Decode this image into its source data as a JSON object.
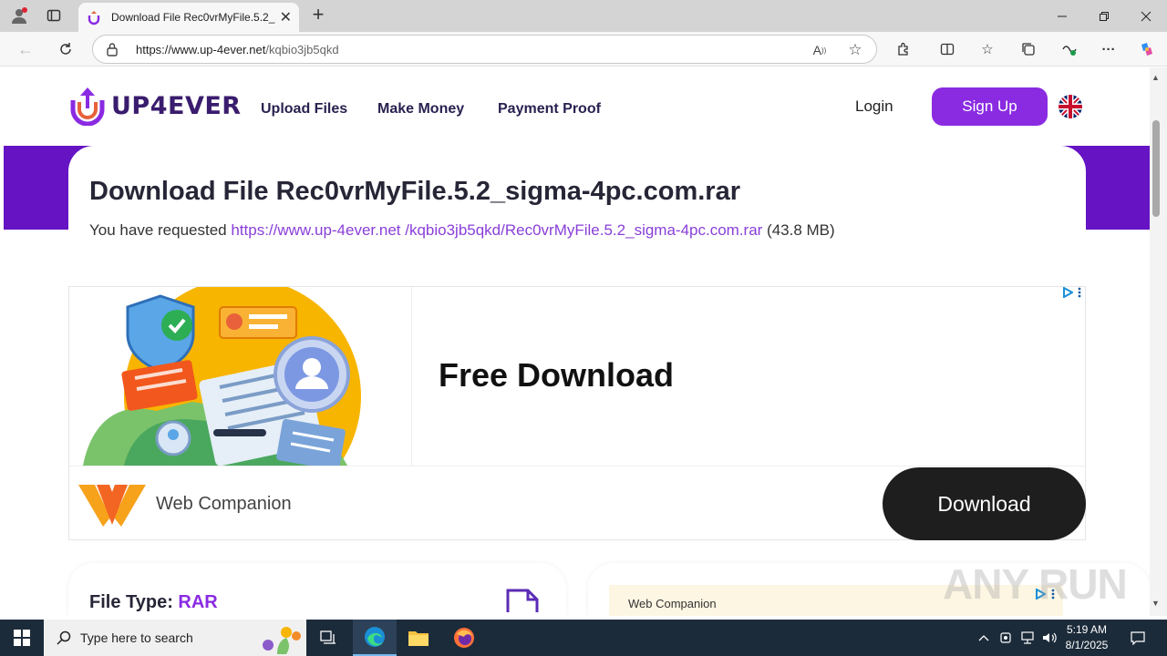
{
  "browser": {
    "tab_title": "Download File Rec0vrMyFile.5.2_s",
    "url_host": "https://www.up-4ever.net",
    "url_path": "/kqbio3jb5qkd"
  },
  "site": {
    "logo_text": "UP4EVER",
    "nav": [
      "Upload Files",
      "Make Money",
      "Payment Proof"
    ],
    "login": "Login",
    "signup": "Sign Up"
  },
  "file": {
    "title": "Download File Rec0vrMyFile.5.2_sigma-4pc.com.rar",
    "requested_prefix": "You have requested ",
    "link": "https://www.up-4ever.net /kqbio3jb5qkd/Rec0vrMyFile.5.2_sigma-4pc.com.rar",
    "size": " (43.8 MB)",
    "type_label": "File Type: ",
    "type_value": "RAR"
  },
  "ad": {
    "headline": "Free Download",
    "brand": "Web Companion",
    "button": "Download",
    "mini_brand": "Web Companion"
  },
  "watermark": "ANY RUN",
  "taskbar": {
    "search_placeholder": "Type here to search",
    "time": "5:19 AM",
    "date": "8/1/2025"
  },
  "colors": {
    "brand_purple": "#8a2be2",
    "band_purple": "#6613c4",
    "taskbar": "#1c2b3a"
  }
}
